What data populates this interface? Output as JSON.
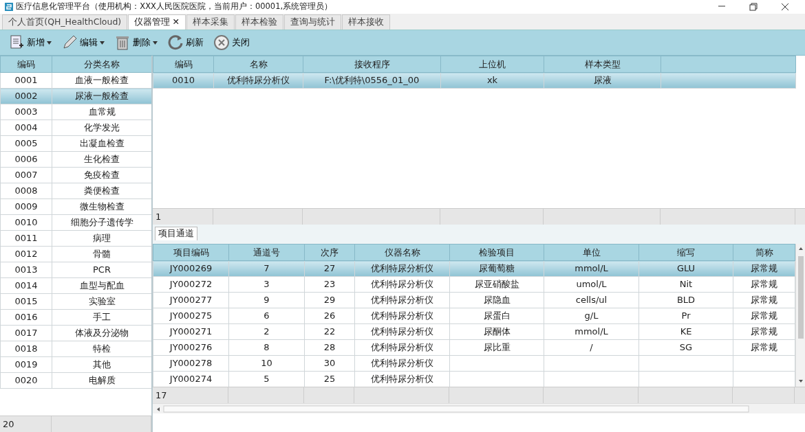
{
  "window": {
    "title": "医疗信息化管理平台（使用机构：XXX人民医院医院，当前用户：00001,系统管理员）"
  },
  "tabs": [
    {
      "label": "个人首页(QH_HealthCloud)",
      "selected": false,
      "closable": false
    },
    {
      "label": "仪器管理",
      "selected": true,
      "closable": true,
      "close_glyph": "✕"
    },
    {
      "label": "样本采集",
      "selected": false,
      "closable": false
    },
    {
      "label": "样本检验",
      "selected": false,
      "closable": false
    },
    {
      "label": "查询与统计",
      "selected": false,
      "closable": false
    },
    {
      "label": "样本接收",
      "selected": false,
      "closable": false
    }
  ],
  "toolbar": [
    {
      "kind": "new",
      "label": "新增",
      "dropdown": true
    },
    {
      "kind": "edit",
      "label": "编辑",
      "dropdown": true
    },
    {
      "kind": "delete",
      "label": "删除",
      "dropdown": true
    },
    {
      "kind": "refresh",
      "label": "刷新",
      "dropdown": false
    },
    {
      "kind": "close",
      "label": "关闭",
      "dropdown": false
    }
  ],
  "categories": {
    "columns": [
      "编码",
      "分类名称"
    ],
    "footer": "20",
    "rows": [
      {
        "code": "0001",
        "name": "血液一般检查",
        "selected": false
      },
      {
        "code": "0002",
        "name": "尿液一般检查",
        "selected": true
      },
      {
        "code": "0003",
        "name": "血常规",
        "selected": false
      },
      {
        "code": "0004",
        "name": "化学发光",
        "selected": false
      },
      {
        "code": "0005",
        "name": "出凝血检查",
        "selected": false
      },
      {
        "code": "0006",
        "name": "生化检查",
        "selected": false
      },
      {
        "code": "0007",
        "name": "免疫检查",
        "selected": false
      },
      {
        "code": "0008",
        "name": "粪便检查",
        "selected": false
      },
      {
        "code": "0009",
        "name": "微生物检查",
        "selected": false
      },
      {
        "code": "0010",
        "name": "细胞分子遗传学",
        "selected": false
      },
      {
        "code": "0011",
        "name": "病理",
        "selected": false
      },
      {
        "code": "0012",
        "name": "骨髓",
        "selected": false
      },
      {
        "code": "0013",
        "name": "PCR",
        "selected": false
      },
      {
        "code": "0014",
        "name": "血型与配血",
        "selected": false
      },
      {
        "code": "0015",
        "name": "实验室",
        "selected": false
      },
      {
        "code": "0016",
        "name": "手工",
        "selected": false
      },
      {
        "code": "0017",
        "name": "体液及分泌物",
        "selected": false
      },
      {
        "code": "0018",
        "name": "特检",
        "selected": false
      },
      {
        "code": "0019",
        "name": "其他",
        "selected": false
      },
      {
        "code": "0020",
        "name": "电解质",
        "selected": false
      }
    ]
  },
  "instruments": {
    "columns": [
      "编码",
      "名称",
      "接收程序",
      "上位机",
      "样本类型"
    ],
    "footer": "1",
    "rows": [
      {
        "cells": [
          "0010",
          "优利特尿分析仪",
          "F:\\优利特\\0556_01_00",
          "xk",
          "尿液"
        ],
        "selected": true
      }
    ]
  },
  "channels": {
    "tab_label": "项目通道",
    "columns": [
      "项目编码",
      "通道号",
      "次序",
      "仪器名称",
      "检验项目",
      "单位",
      "缩写",
      "简称"
    ],
    "footer": "17",
    "rows": [
      {
        "cells": [
          "JY000269",
          "7",
          "27",
          "优利特尿分析仪",
          "尿葡萄糖",
          "mmol/L",
          "GLU",
          "尿常规"
        ],
        "selected": true
      },
      {
        "cells": [
          "JY000272",
          "3",
          "23",
          "优利特尿分析仪",
          "尿亚硝酸盐",
          "umol/L",
          "Nit",
          "尿常规"
        ],
        "selected": false
      },
      {
        "cells": [
          "JY000277",
          "9",
          "29",
          "优利特尿分析仪",
          "尿隐血",
          "cells/ul",
          "BLD",
          "尿常规"
        ],
        "selected": false
      },
      {
        "cells": [
          "JY000275",
          "6",
          "26",
          "优利特尿分析仪",
          "尿蛋白",
          "g/L",
          "Pr",
          "尿常规"
        ],
        "selected": false
      },
      {
        "cells": [
          "JY000271",
          "2",
          "22",
          "优利特尿分析仪",
          "尿酮体",
          "mmol/L",
          "KE",
          "尿常规"
        ],
        "selected": false
      },
      {
        "cells": [
          "JY000276",
          "8",
          "28",
          "优利特尿分析仪",
          "尿比重",
          "/",
          "SG",
          "尿常规"
        ],
        "selected": false
      },
      {
        "cells": [
          "JY000278",
          "10",
          "30",
          "优利特尿分析仪"
        ],
        "selected": false
      },
      {
        "cells": [
          "JY000274",
          "5",
          "25",
          "优利特尿分析仪"
        ],
        "selected": false
      }
    ]
  }
}
